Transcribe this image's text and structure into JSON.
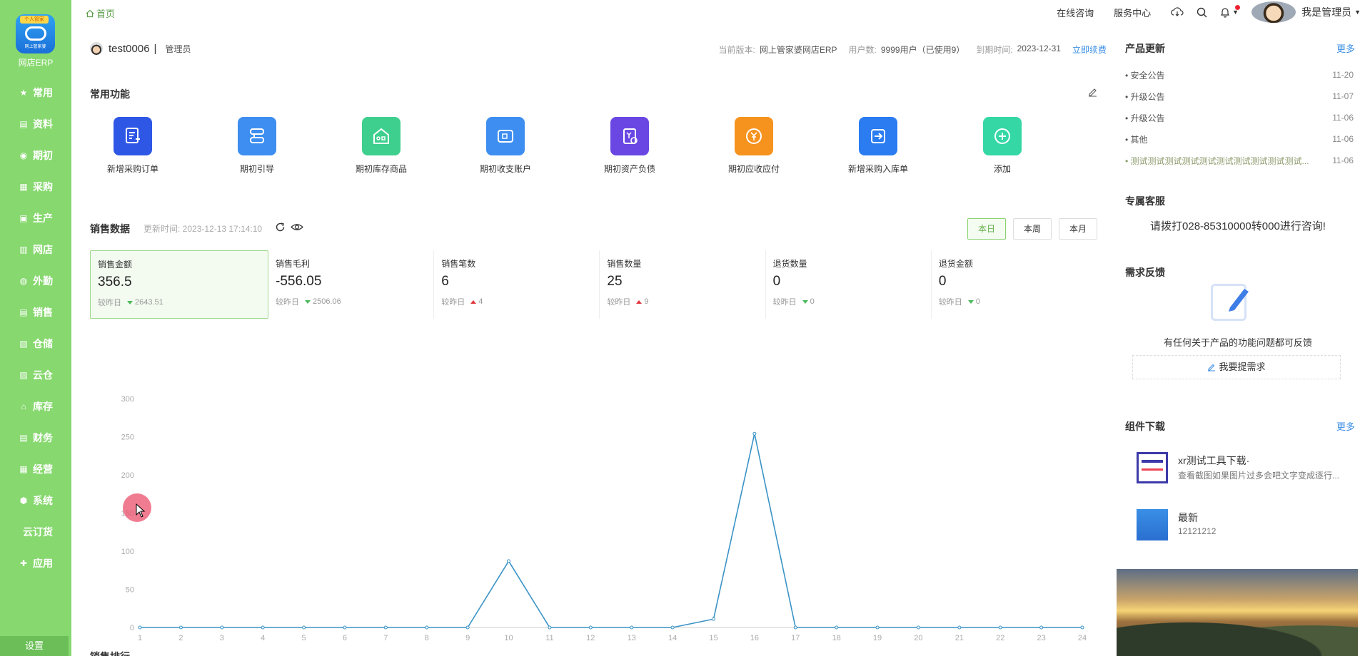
{
  "app": {
    "logo_tag": "个人管家",
    "logo_sub": "网上管家婆",
    "name": "网店ERP"
  },
  "nav": [
    {
      "label": "常用",
      "icon": "star-icon",
      "glyph": "★"
    },
    {
      "label": "资料",
      "icon": "doc-icon",
      "glyph": "▤"
    },
    {
      "label": "期初",
      "icon": "cycle-icon",
      "glyph": "◉"
    },
    {
      "label": "采购",
      "icon": "cart-icon",
      "glyph": "▦"
    },
    {
      "label": "生产",
      "icon": "factory-icon",
      "glyph": "▣"
    },
    {
      "label": "网店",
      "icon": "shop-icon",
      "glyph": "▥"
    },
    {
      "label": "外勤",
      "icon": "field-icon",
      "glyph": "◍"
    },
    {
      "label": "销售",
      "icon": "sales-icon",
      "glyph": "▤"
    },
    {
      "label": "仓储",
      "icon": "warehouse-icon",
      "glyph": "▧"
    },
    {
      "label": "云仓",
      "icon": "cloud-icon",
      "glyph": "▨"
    },
    {
      "label": "库存",
      "icon": "stock-icon",
      "glyph": "⌂"
    },
    {
      "label": "财务",
      "icon": "finance-icon",
      "glyph": "▤"
    },
    {
      "label": "经营",
      "icon": "business-icon",
      "glyph": "▦"
    },
    {
      "label": "系统",
      "icon": "system-icon",
      "glyph": "⬢"
    },
    {
      "label": "云订货",
      "icon": "",
      "glyph": ""
    },
    {
      "label": "应用",
      "icon": "app-icon",
      "glyph": "✚"
    }
  ],
  "settings_label": "设置",
  "topbar": {
    "home": "首页",
    "consult": "在线咨询",
    "service": "服务中心",
    "admin": "我是管理员"
  },
  "user": {
    "name": "test0006",
    "sep": "|",
    "role": "管理员",
    "version_label": "当前版本:",
    "version_value": "网上管家婆网店ERP",
    "users_label": "用户数:",
    "users_value": "9999用户（已使用9）",
    "expire_label": "到期时间:",
    "expire_value": "2023-12-31",
    "renew": "立即续费"
  },
  "common": {
    "title": "常用功能",
    "items": [
      {
        "label": "新增采购订单",
        "color": "#2f57e6",
        "icon": "new-purchase-order-icon"
      },
      {
        "label": "期初引导",
        "color": "#3d8ef0",
        "icon": "guide-icon"
      },
      {
        "label": "期初库存商品",
        "color": "#3ecf8e",
        "icon": "inventory-icon"
      },
      {
        "label": "期初收支账户",
        "color": "#3d8ef0",
        "icon": "wallet-icon"
      },
      {
        "label": "期初资产负债",
        "color": "#6a47e3",
        "icon": "asset-icon"
      },
      {
        "label": "期初应收应付",
        "color": "#f6931f",
        "icon": "receivable-icon"
      },
      {
        "label": "新增采购入库单",
        "color": "#2a7cf0",
        "icon": "stock-in-icon"
      },
      {
        "label": "添加",
        "color": "#35d7a5",
        "icon": "add-icon"
      }
    ]
  },
  "sales": {
    "title": "销售数据",
    "update_time": "更新时间: 2023-12-13 17:14:10",
    "ranges": [
      "本日",
      "本周",
      "本月"
    ],
    "compare_label": "较昨日",
    "kpis": [
      {
        "label": "销售金额",
        "value": "356.5",
        "delta": "2643.51",
        "dir": "down"
      },
      {
        "label": "销售毛利",
        "value": "-556.05",
        "delta": "2506.06",
        "dir": "down"
      },
      {
        "label": "销售笔数",
        "value": "6",
        "delta": "4",
        "dir": "up"
      },
      {
        "label": "销售数量",
        "value": "25",
        "delta": "9",
        "dir": "up"
      },
      {
        "label": "退货数量",
        "value": "0",
        "delta": "0",
        "dir": "down"
      },
      {
        "label": "退货金额",
        "value": "0",
        "delta": "0",
        "dir": "down"
      }
    ]
  },
  "rank_title": "销售排行",
  "chart_data": {
    "type": "line",
    "x": [
      1,
      2,
      3,
      4,
      5,
      6,
      7,
      8,
      9,
      10,
      11,
      12,
      13,
      14,
      15,
      16,
      17,
      18,
      19,
      20,
      21,
      22,
      23,
      24
    ],
    "series": [
      {
        "values": [
          0,
          0,
          0,
          0,
          0,
          0,
          0,
          0,
          0,
          87,
          0,
          0,
          0,
          0,
          11,
          254,
          0,
          0,
          0,
          0,
          0,
          0,
          0,
          0
        ]
      }
    ],
    "yticks": [
      0,
      50,
      100,
      150,
      200,
      250,
      300
    ],
    "ylim": [
      0,
      300
    ],
    "line_color": "#3a93c6"
  },
  "right": {
    "updates_title": "产品更新",
    "more": "更多",
    "updates": [
      {
        "title": "安全公告",
        "date": "11-20"
      },
      {
        "title": "升级公告",
        "date": "11-07"
      },
      {
        "title": "升级公告",
        "date": "11-06"
      },
      {
        "title": "其他",
        "date": "11-06"
      },
      {
        "title": "测试测试测试测试测试测试测试测试测试测试...",
        "date": "11-06"
      }
    ],
    "support_title": "专属客服",
    "support_text": "请拨打028-85310000转000进行咨询!",
    "feedback_title": "需求反馈",
    "feedback_text": "有任何关于产品的功能问题都可反馈",
    "feedback_btn": "我要提需求",
    "download_title": "组件下载",
    "downloads": [
      {
        "name": "xr测试工具下载·",
        "desc": "查看截图如果图片过多会吧文字变成逐行..."
      },
      {
        "name": "最新",
        "desc": "12121212"
      }
    ]
  }
}
